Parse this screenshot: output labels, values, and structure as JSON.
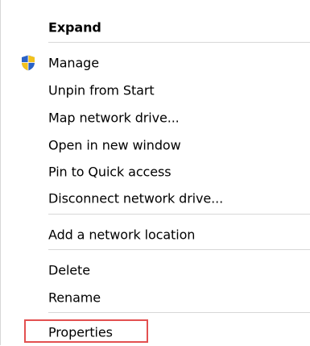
{
  "menu": {
    "items": [
      {
        "label": "Expand"
      },
      {
        "label": "Manage",
        "icon": "uac-shield-icon"
      },
      {
        "label": "Unpin from Start"
      },
      {
        "label": "Map network drive..."
      },
      {
        "label": "Open in new window"
      },
      {
        "label": "Pin to Quick access"
      },
      {
        "label": "Disconnect network drive..."
      },
      {
        "label": "Add a network location"
      },
      {
        "label": "Delete"
      },
      {
        "label": "Rename"
      },
      {
        "label": "Properties"
      }
    ]
  },
  "highlight_color": "#e35050"
}
